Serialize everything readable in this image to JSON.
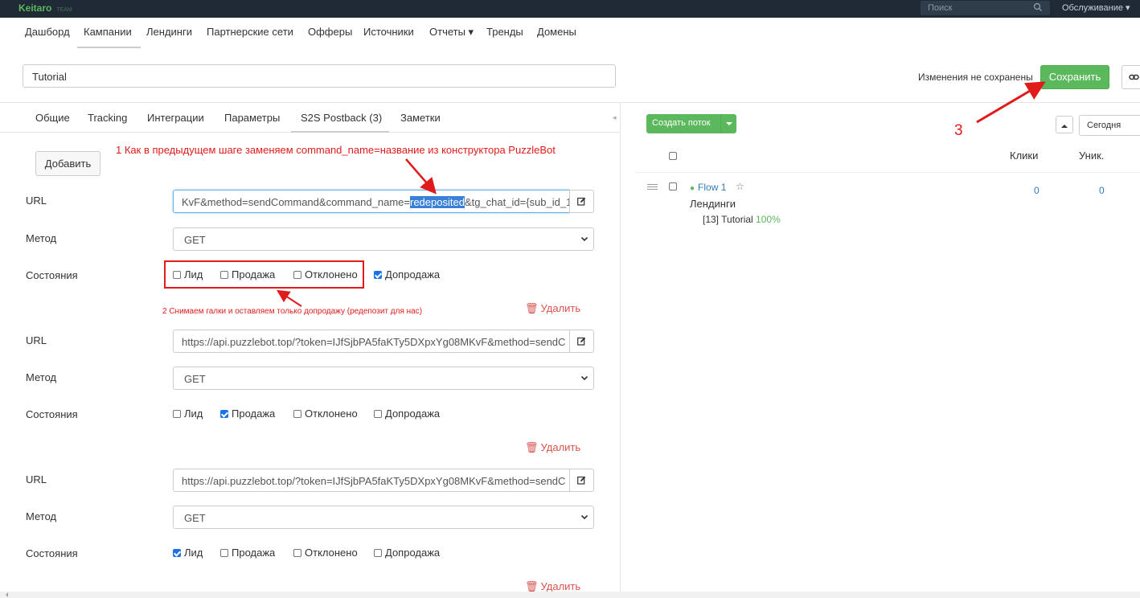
{
  "app": {
    "logo": "Keitaro",
    "edition": "TEAM",
    "search_placeholder": "Поиск",
    "service_menu": "Обслуживание ▾"
  },
  "nav": {
    "items": [
      "Дашборд",
      "Кампании",
      "Лендинги",
      "Партнерские сети",
      "Офферы",
      "Источники",
      "Отчеты ▾",
      "Тренды",
      "Домены"
    ],
    "active": "Кампании"
  },
  "campaign": {
    "name": "Tutorial",
    "unsaved_text": "Изменения не сохранены",
    "save_label": "Сохранить"
  },
  "tabs": {
    "items": [
      "Общие",
      "Tracking",
      "Интеграции",
      "Параметры",
      "S2S Postback (3)",
      "Заметки"
    ],
    "active": "S2S Postback (3)"
  },
  "postbacks": {
    "add_label": "Добавить",
    "url_label": "URL",
    "method_label": "Метод",
    "states_label": "Состояния",
    "delete_label": "Удалить",
    "state_names": [
      "Лид",
      "Продажа",
      "Отклонено",
      "Допродажа"
    ],
    "items": [
      {
        "url_before": "KvF&method=sendCommand&command_name=",
        "url_selected": "redeposited",
        "url_after": "&tg_chat_id={sub_id_1",
        "method": "GET",
        "states": [
          false,
          false,
          false,
          true
        ]
      },
      {
        "url": "https://api.puzzlebot.top/?token=IJfSjbPA5faKTy5DXpxYg08MKvF&method=sendC",
        "method": "GET",
        "states": [
          false,
          true,
          false,
          false
        ]
      },
      {
        "url": "https://api.puzzlebot.top/?token=IJfSjbPA5faKTy5DXpxYg08MKvF&method=sendC",
        "method": "GET",
        "states": [
          true,
          false,
          false,
          false
        ]
      }
    ]
  },
  "annotations": {
    "step1": "1 Как в предыдущем шаге заменяем command_name=название из конструктора PuzzleBot",
    "step2": "2 Снимаем галки и оставляем только допродажу (редепозит для нас)",
    "step3": "3"
  },
  "flows": {
    "create_label": "Создать поток",
    "date_range": "Сегодня",
    "columns": [
      "Клики",
      "Уник."
    ],
    "items": [
      {
        "name": "Flow 1",
        "section": "Лендинги",
        "landing": "[13] Tutorial",
        "landing_share": "100%",
        "clicks": "0",
        "uniques": "0"
      }
    ]
  },
  "colors": {
    "accent": "#5cb85c",
    "topbar": "#1f2a36",
    "annotation": "#e01b1b",
    "link": "#337ab7"
  },
  "icons": [
    "search-icon",
    "edit-icon",
    "chevron-down-icon",
    "trash-icon",
    "star-icon",
    "drag-handle-icon",
    "link-icon"
  ]
}
